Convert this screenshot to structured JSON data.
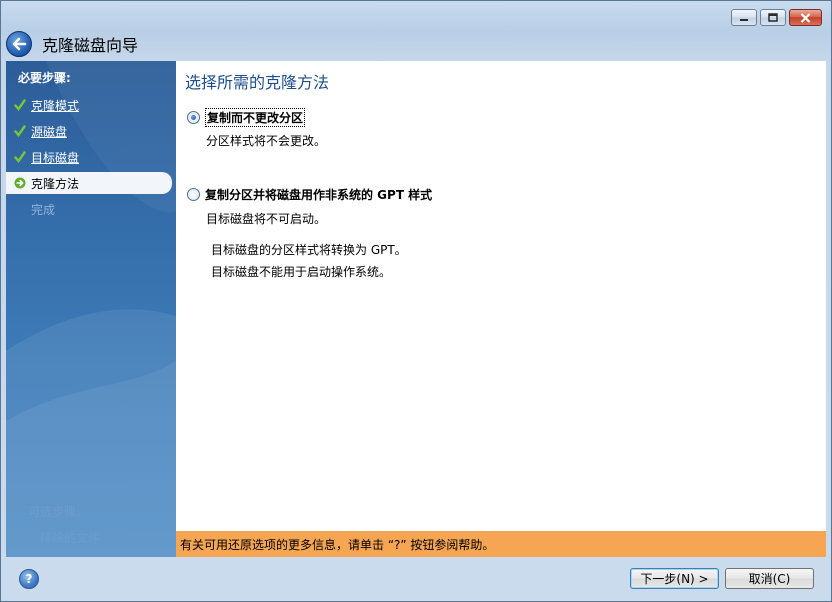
{
  "window": {
    "title": "克隆磁盘向导",
    "controls": {
      "minimize": "minimize-icon",
      "maximize": "maximize-icon",
      "close": "close-icon"
    }
  },
  "sidebar": {
    "heading": "必要步骤:",
    "steps": [
      {
        "label": "克隆模式",
        "state": "done",
        "icon": "checkmark-icon"
      },
      {
        "label": "源磁盘",
        "state": "done",
        "icon": "checkmark-icon"
      },
      {
        "label": "目标磁盘",
        "state": "done",
        "icon": "checkmark-icon"
      },
      {
        "label": "克隆方法",
        "state": "current",
        "icon": "arrow-right-icon"
      },
      {
        "label": "完成",
        "state": "pending"
      }
    ],
    "optional_heading": "可选步骤:",
    "optional_item": "排除的文件"
  },
  "main": {
    "heading": "选择所需的克隆方法",
    "options": [
      {
        "label": "复制而不更改分区",
        "selected": true,
        "description": "分区样式将不会更改。"
      },
      {
        "label": "复制分区并将磁盘用作非系统的 GPT 样式",
        "selected": false,
        "description": "目标磁盘将不可启动。",
        "notes": [
          "目标磁盘的分区样式将转换为 GPT。",
          "目标磁盘不能用于启动操作系统。"
        ]
      }
    ]
  },
  "infobar": {
    "text": "有关可用还原选项的更多信息，请单击 “?” 按钮参阅帮助。"
  },
  "buttons": {
    "help": "?",
    "next": "下一步(N) >",
    "cancel": "取消(C)"
  },
  "colors": {
    "sidebar": "#336ca8",
    "heading": "#1e4e8c",
    "infobar": "#f6a553",
    "check": "#6fbf2a"
  }
}
